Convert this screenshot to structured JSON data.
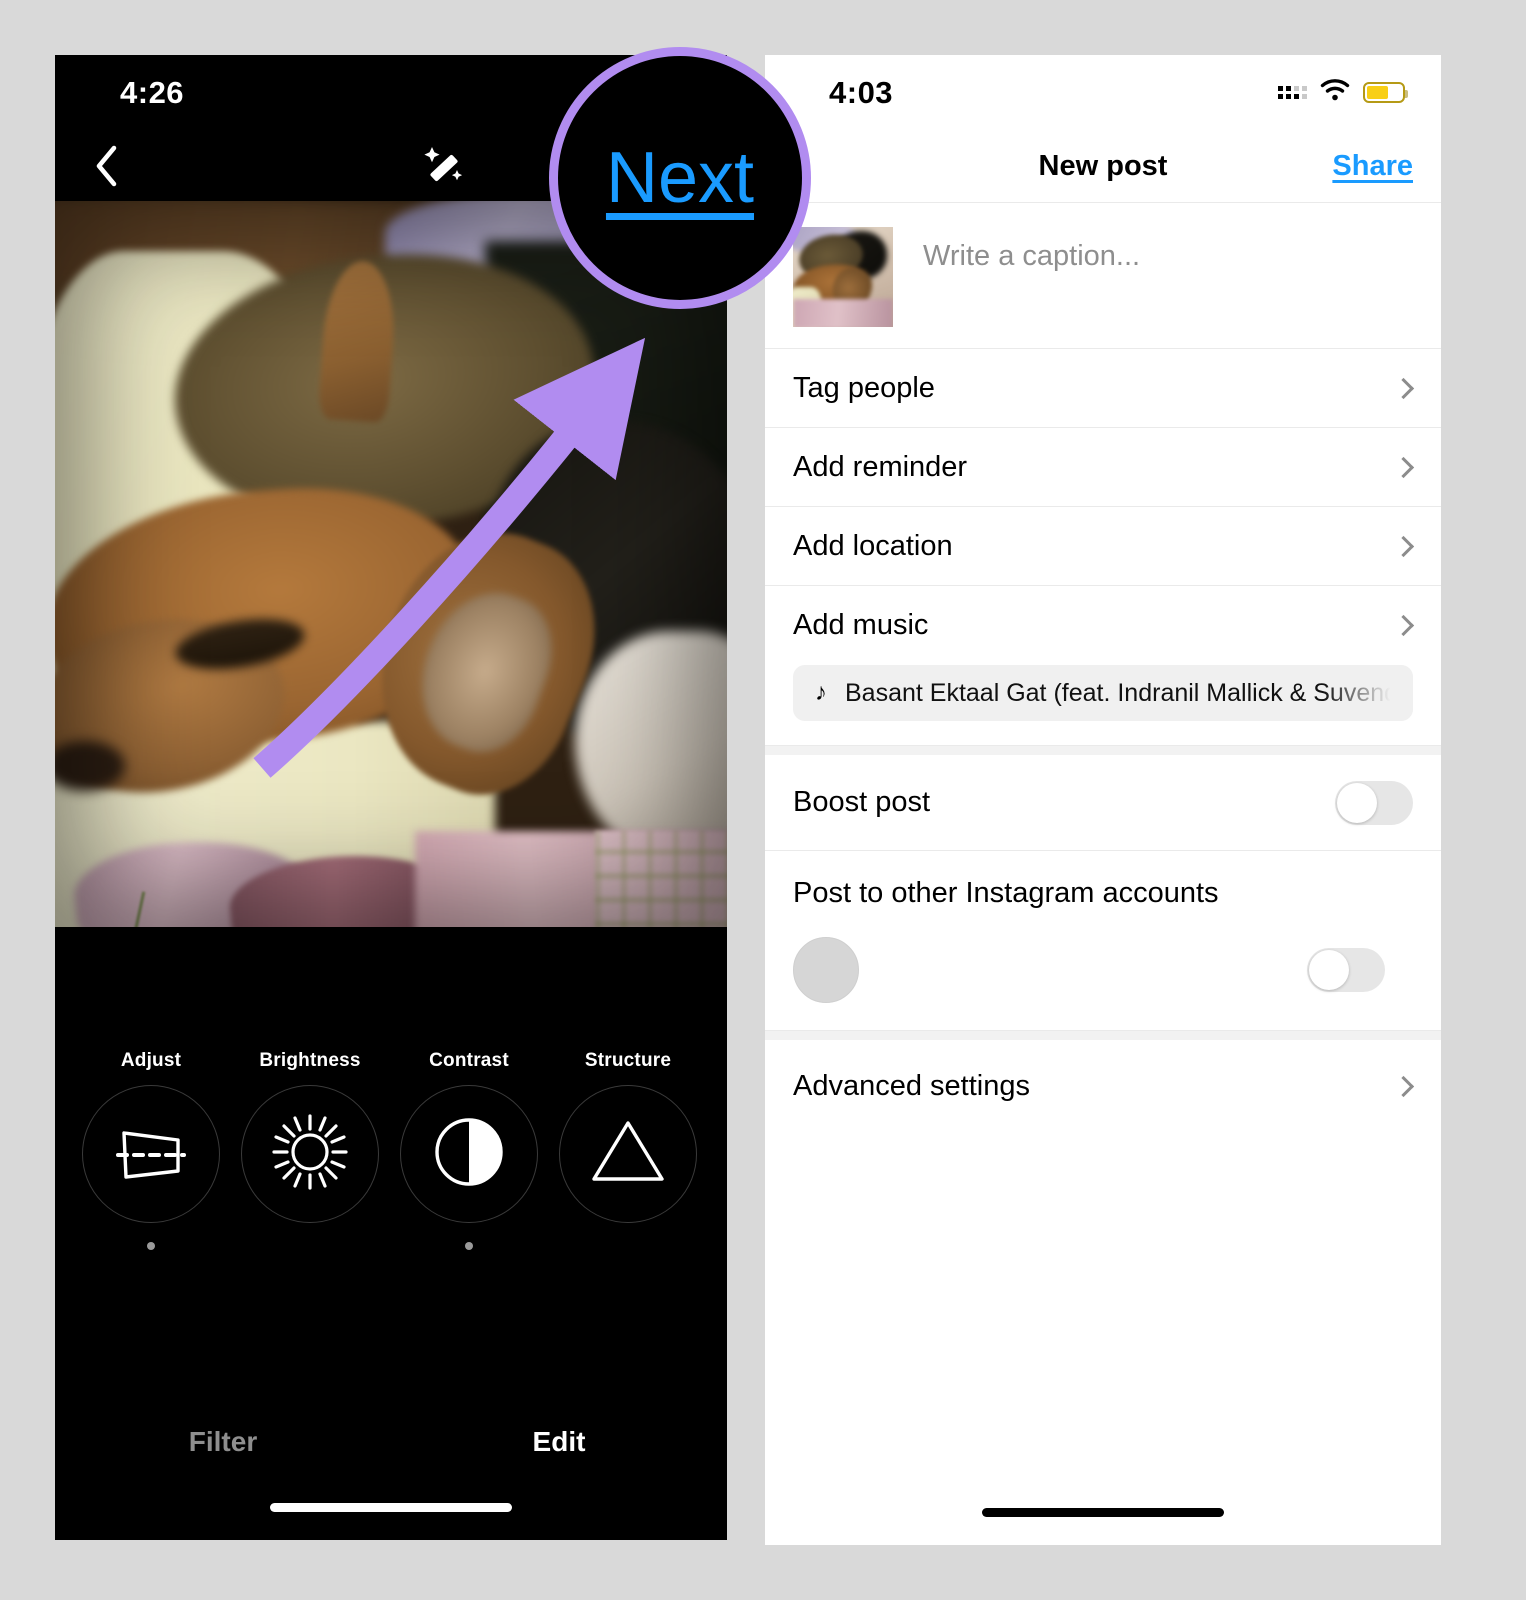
{
  "left_phone": {
    "status": {
      "time": "4:26"
    },
    "nav": {
      "back_icon": "chevron-left-icon",
      "magic_icon": "magic-wand-icon",
      "next_label": "Next"
    },
    "photo_alt": "sleeping corgi dog on pink floral blanket",
    "tools": [
      {
        "label": "Adjust",
        "icon": "adjust-icon",
        "has_dot": true
      },
      {
        "label": "Brightness",
        "icon": "brightness-sun-icon",
        "has_dot": false
      },
      {
        "label": "Contrast",
        "icon": "contrast-half-circle-icon",
        "has_dot": true
      },
      {
        "label": "Structure",
        "icon": "structure-triangle-icon",
        "has_dot": false
      }
    ],
    "tabs": [
      {
        "label": "Filter",
        "active": false
      },
      {
        "label": "Edit",
        "active": true
      }
    ]
  },
  "magnifier": {
    "label": "Next",
    "ring_color": "#b18cf0",
    "text_color": "#1a9bff",
    "background": "#000000"
  },
  "annotation": {
    "arrow_color": "#b18cf0",
    "arrow_points_to": "Next"
  },
  "right_phone": {
    "status": {
      "time": "4:03",
      "cellular_icon": "cellular-bars-icon",
      "wifi_icon": "wifi-icon",
      "battery_icon": "battery-low-power-icon",
      "battery_color": "#f8cf16"
    },
    "nav": {
      "title": "New post",
      "share_label": "Share",
      "share_color": "#1a9bff"
    },
    "caption": {
      "placeholder": "Write a caption...",
      "thumbnail_alt": "post photo thumbnail"
    },
    "rows": [
      {
        "label": "Tag people",
        "chevron": "chevron-right-icon"
      },
      {
        "label": "Add reminder",
        "chevron": "chevron-right-icon"
      },
      {
        "label": "Add location",
        "chevron": "chevron-right-icon"
      },
      {
        "label": "Add music",
        "chevron": "chevron-right-icon"
      }
    ],
    "music_chip": {
      "icon": "music-note-icon",
      "title": "Basant Ektaal Gat (feat. Indranil Mallick & Suvendu Bannerjee) · J"
    },
    "boost": {
      "label": "Boost post",
      "toggle_on": false
    },
    "accounts": {
      "label": "Post to other Instagram accounts",
      "toggle_on": false,
      "avatar": "account-avatar"
    },
    "advanced": {
      "label": "Advanced settings",
      "chevron": "chevron-right-icon"
    }
  }
}
